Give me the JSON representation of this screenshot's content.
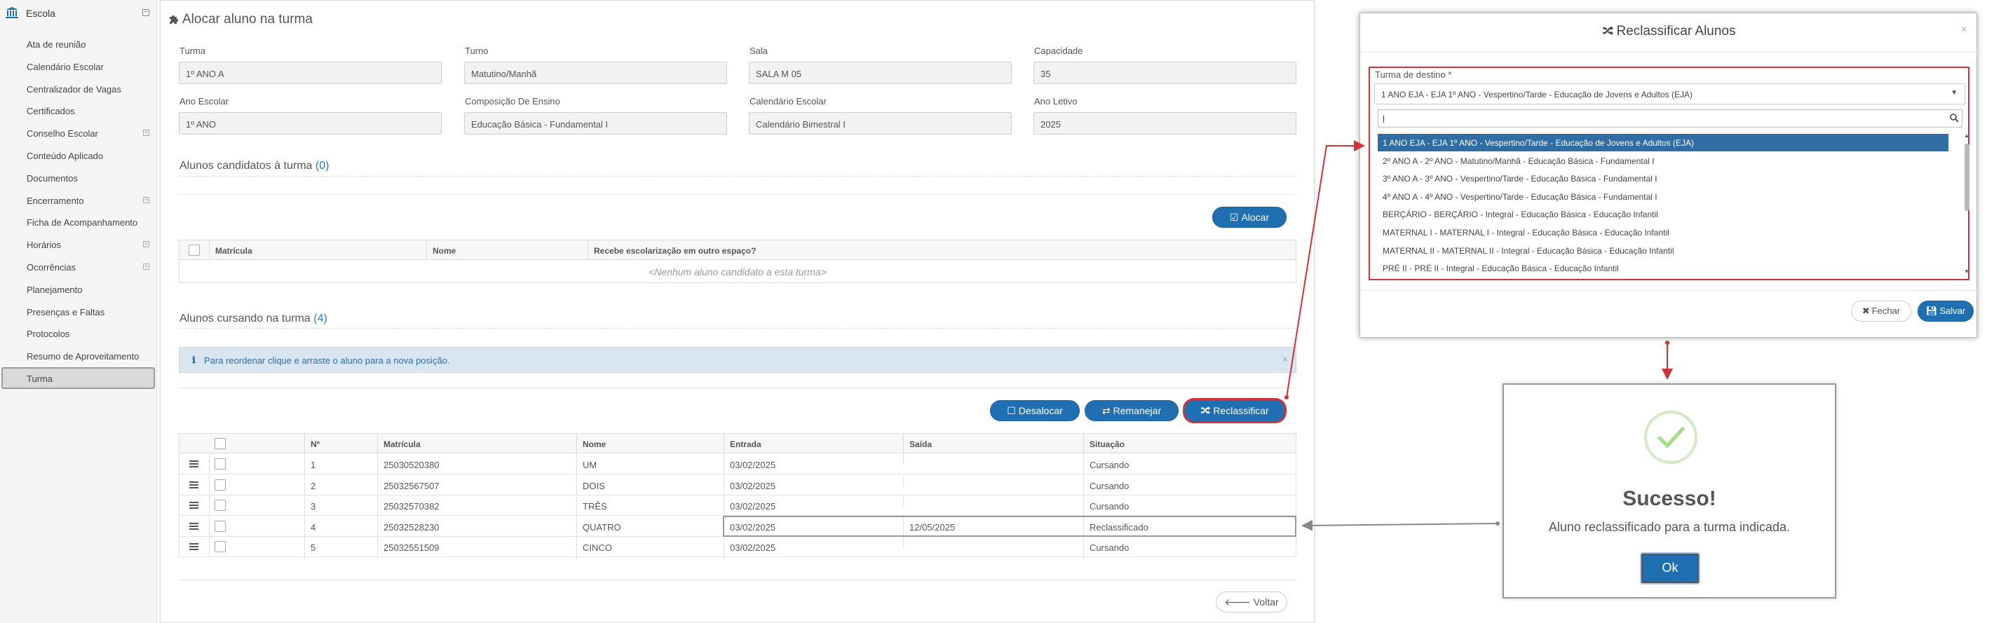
{
  "sidebar": {
    "section": "Escola",
    "items": [
      {
        "label": "Ata de reunião",
        "expandable": false
      },
      {
        "label": "Calendário Escolar",
        "expandable": false
      },
      {
        "label": "Centralizador de Vagas",
        "expandable": false
      },
      {
        "label": "Certificados",
        "expandable": false
      },
      {
        "label": "Conselho Escolar",
        "expandable": true
      },
      {
        "label": "Conteúdo Aplicado",
        "expandable": false
      },
      {
        "label": "Documentos",
        "expandable": false
      },
      {
        "label": "Encerramento",
        "expandable": true
      },
      {
        "label": "Ficha de Acompanhamento",
        "expandable": false
      },
      {
        "label": "Horários",
        "expandable": true
      },
      {
        "label": "Ocorrências",
        "expandable": true
      },
      {
        "label": "Planejamento",
        "expandable": false
      },
      {
        "label": "Presenças e Faltas",
        "expandable": false
      },
      {
        "label": "Protocolos",
        "expandable": false
      },
      {
        "label": "Resumo de Aproveitamento",
        "expandable": false
      },
      {
        "label": "Turma",
        "expandable": false,
        "active": true
      }
    ]
  },
  "page": {
    "title": "Alocar aluno na turma",
    "fields": {
      "turma": {
        "label": "Turma",
        "value": "1º ANO A"
      },
      "turno": {
        "label": "Turno",
        "value": "Matutino/Manhã"
      },
      "sala": {
        "label": "Sala",
        "value": "SALA M 05"
      },
      "capacidade": {
        "label": "Capacidade",
        "value": "35"
      },
      "ano_escolar": {
        "label": "Ano Escolar",
        "value": "1º ANO"
      },
      "composicao": {
        "label": "Composição De Ensino",
        "value": "Educação Básica - Fundamental I"
      },
      "calendario": {
        "label": "Calendário Escolar",
        "value": "Calendário Bimestral I"
      },
      "ano_letivo": {
        "label": "Ano Letivo",
        "value": "2025"
      }
    },
    "candidatos": {
      "title": "Alunos candidatos à turma",
      "count": "(0)",
      "alocar_label": "Alocar",
      "headers": [
        "Matrícula",
        "Nome",
        "Recebe escolarização em outro espaço?"
      ],
      "empty": "<Nenhum aluno candidato a esta turma>"
    },
    "cursando": {
      "title": "Alunos cursando na turma",
      "count": "(4)",
      "info": "Para reordenar clique e arraste o aluno para a nova posição.",
      "desalocar_label": "Desalocar",
      "remanejar_label": "Remanejar",
      "reclassificar_label": "Reclassificar",
      "headers": [
        "Nº",
        "Matrícula",
        "Nome",
        "Entrada",
        "Saída",
        "Situação"
      ],
      "rows": [
        {
          "n": "1",
          "matricula": "25030520380",
          "nome": "UM",
          "entrada": "03/02/2025",
          "saida": "",
          "situacao": "Cursando"
        },
        {
          "n": "2",
          "matricula": "25032567507",
          "nome": "DOIS",
          "entrada": "03/02/2025",
          "saida": "",
          "situacao": "Cursando"
        },
        {
          "n": "3",
          "matricula": "25032570382",
          "nome": "TRÊS",
          "entrada": "03/02/2025",
          "saida": "",
          "situacao": "Cursando"
        },
        {
          "n": "4",
          "matricula": "25032528230",
          "nome": "QUATRO",
          "entrada": "03/02/2025",
          "saida": "12/05/2025",
          "situacao": "Reclassificado"
        },
        {
          "n": "5",
          "matricula": "25032551509",
          "nome": "CINCO",
          "entrada": "03/02/2025",
          "saida": "",
          "situacao": "Cursando"
        }
      ]
    },
    "voltar_label": "Voltar"
  },
  "modal": {
    "title": "Reclassificar Alunos",
    "field_label": "Turma de destino *",
    "selected": "1 ANO EJA - EJA 1º ANO - Vespertino/Tarde - Educação de Jovens e Adultos (EJA)",
    "search_value": "",
    "options": [
      "1 ANO EJA - EJA 1º ANO - Vespertino/Tarde - Educação de Jovens e Adultos (EJA)",
      "2º ANO A - 2º ANO - Matutino/Manhã - Educação Básica - Fundamental I",
      "3º ANO A - 3º ANO - Vespertino/Tarde - Educação Básica - Fundamental I",
      "4º ANO A - 4º ANO - Vespertino/Tarde - Educação Básica - Fundamental I",
      "BERÇÁRIO - BERÇÁRIO - Integral - Educação Básica - Educação Infantil",
      "MATERNAL I - MATERNAL I - Integral - Educação Básica - Educação Infantil",
      "MATERNAL II - MATERNAL II - Integral - Educação Básica - Educação Infantil",
      "PRÉ II - PRÉ II - Integral - Educação Básica - Educação Infantil"
    ],
    "fechar_label": "Fechar",
    "salvar_label": "Salvar"
  },
  "success": {
    "title": "Sucesso!",
    "message": "Aluno reclassificado para a turma indicada.",
    "ok_label": "Ok"
  },
  "colors": {
    "primary": "#1f6fb2",
    "highlight_red": "#d43038",
    "success_green": "#a5dc86"
  }
}
